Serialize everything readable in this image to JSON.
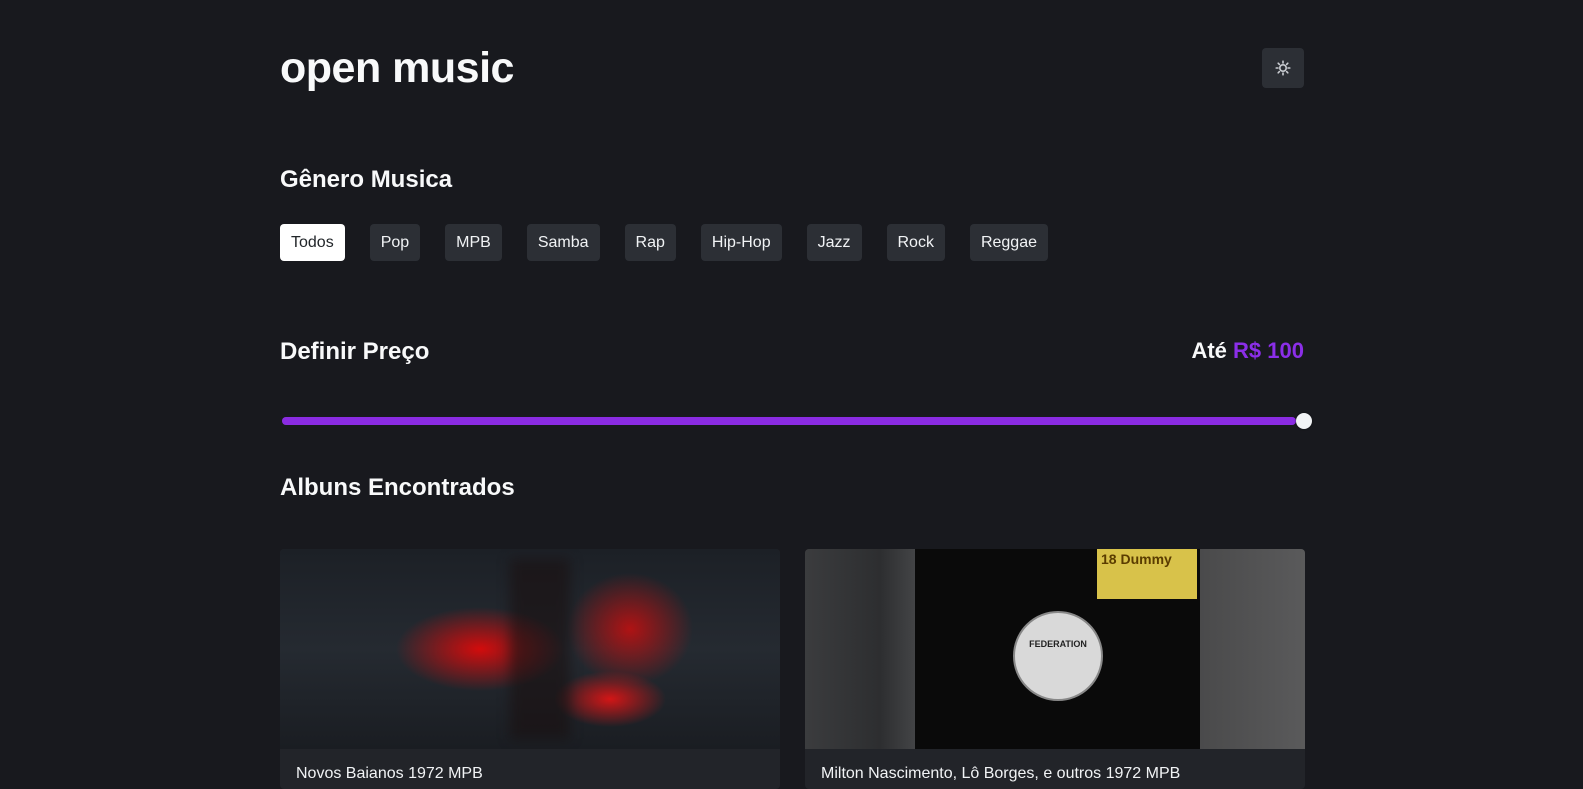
{
  "app": {
    "title": "open music"
  },
  "header": {
    "theme_toggle_icon": "sun-gear-icon"
  },
  "genres": {
    "title": "Gênero Musica",
    "items": [
      {
        "label": "Todos",
        "active": true
      },
      {
        "label": "Pop",
        "active": false
      },
      {
        "label": "MPB",
        "active": false
      },
      {
        "label": "Samba",
        "active": false
      },
      {
        "label": "Rap",
        "active": false
      },
      {
        "label": "Hip-Hop",
        "active": false
      },
      {
        "label": "Jazz",
        "active": false
      },
      {
        "label": "Rock",
        "active": false
      },
      {
        "label": "Reggae",
        "active": false
      }
    ]
  },
  "price": {
    "title": "Definir Preço",
    "prefix": "Até",
    "amount": "R$ 100",
    "slider_fraction": 1.0
  },
  "albums": {
    "title": "Albuns Encontrados",
    "cards": [
      {
        "text": "Novos Baianos   1972   MPB"
      },
      {
        "text": "Milton Nascimento, Lô Borges, e outros   1972   MPB"
      }
    ],
    "cover_2_label": "FEDERATION",
    "cover_2_sticker": "18 Dummy"
  },
  "colors": {
    "background": "#18191e",
    "accent": "#8a2be2",
    "button_bg": "#2c2f35"
  }
}
